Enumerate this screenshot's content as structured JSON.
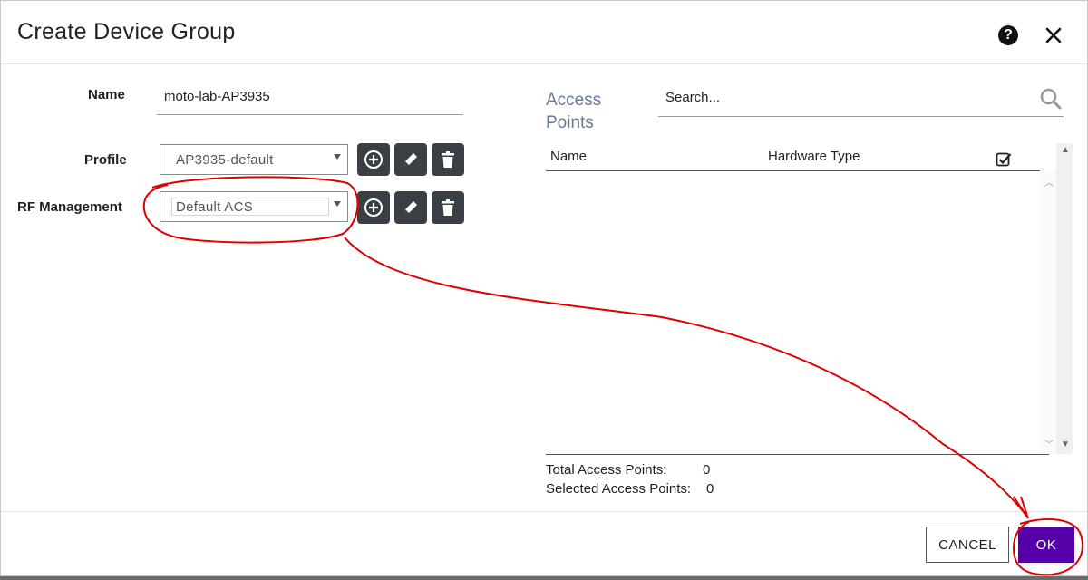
{
  "dialog": {
    "title": "Create Device Group",
    "help_icon": "help-icon",
    "help_glyph": "?",
    "close_icon": "close-icon"
  },
  "form": {
    "name_label": "Name",
    "name_value": "moto-lab-AP3935",
    "profile_label": "Profile",
    "profile_value": "AP3935-default",
    "rf_label": "RF Management",
    "rf_value": "Default ACS",
    "action_icons": [
      "add-circle-icon",
      "edit-pencil-icon",
      "trash-icon"
    ]
  },
  "access_points": {
    "title_line1": "Access",
    "title_line2": "Points",
    "search_placeholder": "Search...",
    "columns": {
      "name": "Name",
      "hardware_type": "Hardware Type",
      "select_all_icon": "checkbox-checked-icon"
    },
    "rows": [],
    "total_label": "Total Access Points:",
    "total_value": "0",
    "selected_label": "Selected Access Points:",
    "selected_value": "0"
  },
  "footer": {
    "cancel_label": "CANCEL",
    "ok_label": "OK"
  },
  "colors": {
    "primary": "#5500a8",
    "icon_button": "#3a3f45",
    "annotation": "#e00000"
  }
}
